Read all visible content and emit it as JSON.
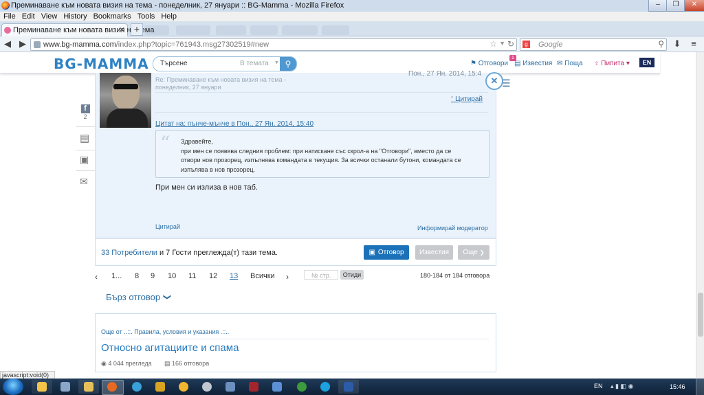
{
  "window": {
    "title": "Преминаване към новата визия на тема - понеделник, 27 януари :: BG-Mamma - Mozilla Firefox",
    "menu": [
      "File",
      "Edit",
      "View",
      "History",
      "Bookmarks",
      "Tools",
      "Help"
    ]
  },
  "tabs": [
    {
      "label": "Преминаване към новата визия на тема"
    }
  ],
  "navbar": {
    "url_domain": "www.bg-mamma.com",
    "url_path": "/index.php?topic=761943.msg27302519#new",
    "search_placeholder": "Google"
  },
  "site": {
    "logo": "BG-MAMMA",
    "search_placeholder": "Търсене",
    "search_scope": "В темата",
    "links": {
      "replies": "Отговори",
      "replies_badge": "1",
      "notifications": "Известия",
      "mail": "Поща",
      "user": "Пипита",
      "lang": "EN"
    }
  },
  "share": {
    "fb_count": "2"
  },
  "post": {
    "subject": "Re: Преминаване към новата визия на тема -",
    "subject_line2": "понеделник, 27 януари",
    "date": "Пон., 27 Ян. 2014, 15:4",
    "quote_action": "Цитирай",
    "quote_header": "Цитат на: пънче-мънче в Пон., 27 Ян. 2014, 15:40",
    "quote_lines": [
      "Здравейте,",
      "при мен се появява следния проблем: при натискане със скрол-а на \"Отговори\", вместо да се",
      "отвори нов прозорец, изпълнява командата в текущия. За всички останали бутони, командата се",
      "изпълява в нов прозорец."
    ],
    "body": "При мен си излиза в нов таб.",
    "bottom_quote": "Цитирай",
    "report": "Информирай модератор"
  },
  "footer": {
    "users_link": "33 Потребители",
    "users_rest": " и 7 Гости преглежда(т) тази тема.",
    "reply_btn": "Отговор",
    "notify_btn": "Известия",
    "more_btn": "Още"
  },
  "pagination": {
    "items": [
      "1...",
      "8",
      "9",
      "10",
      "11",
      "12",
      "13"
    ],
    "current": "13",
    "all": "Всички",
    "page_placeholder": "№ стр.",
    "go": "Отиди",
    "summary": "180-184 от 184 отговора"
  },
  "quick_reply": "Бърз отговор",
  "more_from": {
    "header": "Още от ..::. Правила, условия и указания .::..",
    "title": "Относно агитациите и спама",
    "views": "4 044 прегледа",
    "replies": "166 отговора"
  },
  "statusbar": "javascript:void(0)",
  "taskbar": {
    "lang": "EN",
    "time": "15:46"
  },
  "colors": {
    "accent": "#1c72b8",
    "link": "#2d6fa4",
    "post_bg": "#eaf3fc"
  }
}
